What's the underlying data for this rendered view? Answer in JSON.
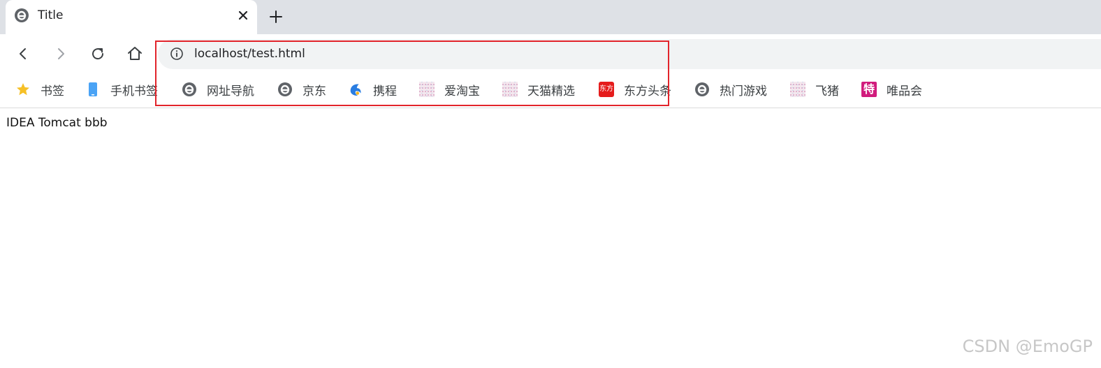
{
  "tab": {
    "title": "Title",
    "close_icon": "close-icon"
  },
  "toolbar": {
    "back_icon": "back-arrow-icon",
    "forward_icon": "forward-arrow-icon",
    "reload_icon": "reload-icon",
    "home_icon": "home-icon"
  },
  "omnibox": {
    "url": "localhost/test.html",
    "info_icon": "info-icon"
  },
  "bookmarks": [
    {
      "label": "书签",
      "icon": "star-icon",
      "color": "#f6c026"
    },
    {
      "label": "手机书签",
      "icon": "phone-icon",
      "color": "#4aa3f5"
    },
    {
      "label": "网址导航",
      "icon": "browser-e-icon",
      "color": "#5f6368"
    },
    {
      "label": "京东",
      "icon": "browser-e-icon",
      "color": "#5f6368"
    },
    {
      "label": "携程",
      "icon": "dolphin-icon",
      "color": "#2a7de1"
    },
    {
      "label": "爱淘宝",
      "icon": "grid-favicon-icon",
      "color": "#e0a0c0"
    },
    {
      "label": "天猫精选",
      "icon": "grid-favicon-icon",
      "color": "#e0a0c0"
    },
    {
      "label": "东方头条",
      "icon": "news-icon",
      "color": "#e51c1c",
      "icon_text": "东方"
    },
    {
      "label": "热门游戏",
      "icon": "browser-e-icon",
      "color": "#5f6368"
    },
    {
      "label": "飞猪",
      "icon": "grid-favicon-icon",
      "color": "#e0a0c0"
    },
    {
      "label": "唯品会",
      "icon": "vip-icon",
      "color": "#d11c7d",
      "icon_text": "特"
    }
  ],
  "page": {
    "body_text": "IDEA Tomcat bbb"
  },
  "watermark": "CSDN @EmoGP",
  "colors": {
    "highlight": "#e2242b",
    "tabstrip": "#dee1e6",
    "omnibox": "#f1f3f4"
  }
}
